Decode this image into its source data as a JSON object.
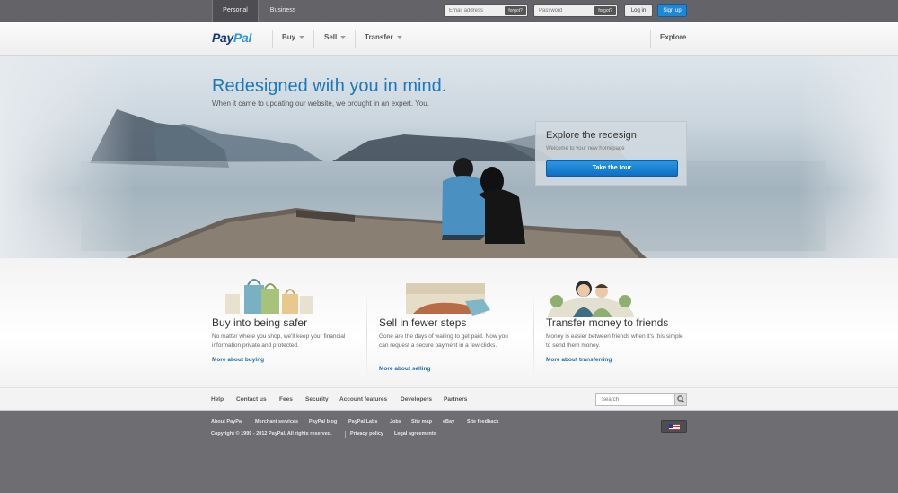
{
  "topbar": {
    "tabs": [
      "Personal",
      "Business"
    ],
    "email_placeholder": "Email address",
    "password_placeholder": "Password",
    "forgot": "forgot?",
    "login": "Log in",
    "signup": "Sign up"
  },
  "nav": {
    "logo_part1": "Pay",
    "logo_part2": "Pal",
    "items": [
      "Buy",
      "Sell",
      "Transfer"
    ],
    "explore": "Explore"
  },
  "hero": {
    "title": "Redesigned with you in mind.",
    "subtitle": "When it came to updating our website, we brought in an expert. You.",
    "cta_title": "Explore the redesign",
    "cta_welcome": "Welcome to your new homepage",
    "cta_button": "Take the tour"
  },
  "features": [
    {
      "title": "Buy into being safer",
      "text": "No matter where you shop, we'll keep your financial information private and protected.",
      "link": "More about buying"
    },
    {
      "title": "Sell in fewer steps",
      "text": "Gone are the days of waiting to get paid. Now you can request a secure payment in a few clicks.",
      "link": "More about selling"
    },
    {
      "title": "Transfer money to friends",
      "text": "Money is easier between friends when it's this simple to send them money.",
      "link": "More about transferring"
    }
  ],
  "footer_links": [
    "Help",
    "Contact us",
    "Fees",
    "Security",
    "Account features",
    "Developers",
    "Partners"
  ],
  "search_placeholder": "Search",
  "dark_links": [
    "About PayPal",
    "Merchant services",
    "PayPal blog",
    "PayPal Labs",
    "Jobs",
    "Site map",
    "eBay",
    "Site feedback"
  ],
  "copyright": "Copyright © 1999 - 2012 PayPal. All rights reserved.",
  "legal_links": [
    "Privacy policy",
    "Legal agreements"
  ],
  "colors": {
    "brand_dark": "#1b3a7d",
    "brand_light": "#2d9ad8",
    "accent": "#1f88d6"
  }
}
